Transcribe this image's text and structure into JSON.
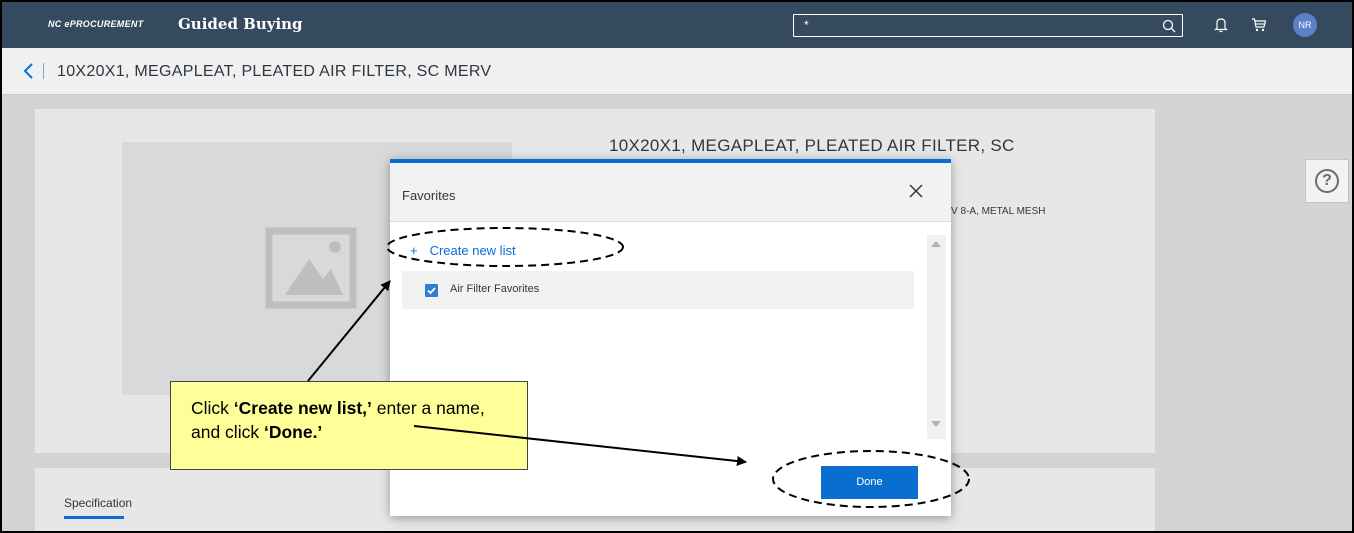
{
  "header": {
    "brand_small": "NC ePROCUREMENT",
    "brand_title": "Guided Buying",
    "search_value": "*",
    "avatar_initials": "NR"
  },
  "subheader": {
    "page_title": "10X20X1, MEGAPLEAT, PLEATED AIR FILTER, SC MERV"
  },
  "product": {
    "title": "10X20X1, MEGAPLEAT, PLEATED AIR FILTER, SC",
    "description_fragment": "V 8-A, METAL MESH",
    "help_label": "?",
    "tab_specification": "Specification"
  },
  "dialog": {
    "title": "Favorites",
    "create_new_list": "Create new list",
    "create_plus": "+",
    "lists": [
      {
        "label": "Air Filter Favorites",
        "checked": true
      }
    ],
    "done_label": "Done"
  },
  "callout": {
    "part1": "Click ",
    "bold1": "‘Create new list,’",
    "part2": " enter a name, and click ",
    "bold2": "‘Done.’"
  },
  "colors": {
    "topbar": "#354a5f",
    "accent": "#0a6ed1",
    "callout_bg": "#ffff99"
  }
}
